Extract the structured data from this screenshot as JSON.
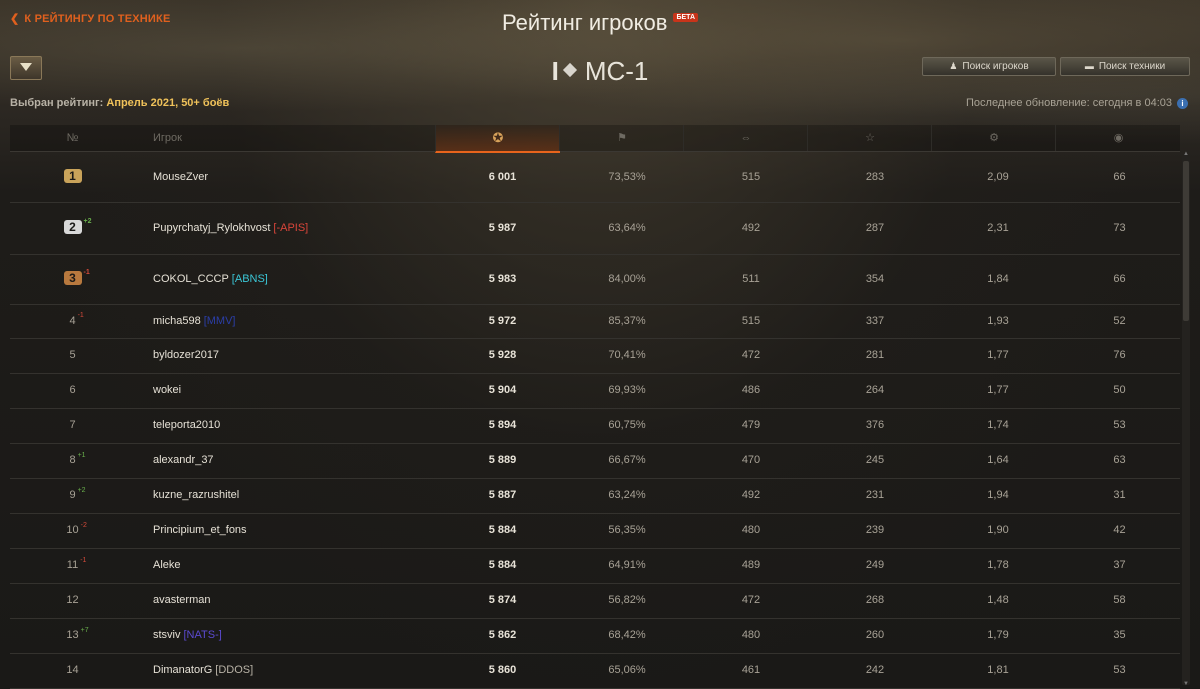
{
  "nav": {
    "back_label": "К РЕЙТИНГУ ПО ТЕХНИКЕ"
  },
  "header": {
    "title": "Рейтинг игроков",
    "beta_badge": "БЕТА"
  },
  "vehicle": {
    "tier": "I",
    "name": "МС-1"
  },
  "buttons": {
    "search_players": "Поиск игроков",
    "search_vehicles": "Поиск техники"
  },
  "rating": {
    "label": "Выбран рейтинг:",
    "value": "Апрель 2021, 50+ боёв"
  },
  "updated": {
    "label": "Последнее обновление: сегодня в 04:03"
  },
  "columns": {
    "rank": "№",
    "player": "Игрок",
    "score_icon": "medal-icon",
    "winrate_icon": "flag-icon",
    "damage_icon": "damage-icon",
    "experience_icon": "star-icon",
    "frags_icon": "destroyed-icon",
    "spotted_icon": "spotted-icon"
  },
  "colors": {
    "accent": "#e8641c",
    "gold": "#f0c25a",
    "up": "#6ab04c",
    "down": "#d34a3a"
  },
  "rows": [
    {
      "rank": "1",
      "medal": "gold",
      "delta": "",
      "player": "MouseZver",
      "clan": "",
      "clan_color": "",
      "score": "6 001",
      "winrate": "73,53%",
      "damage": "515",
      "exp": "283",
      "frags": "2,09",
      "spotted": "66"
    },
    {
      "rank": "2",
      "medal": "silver",
      "delta": "+2",
      "player": "Pupyrchatyj_Rylokhvost",
      "clan": "[-APIS]",
      "clan_color": "red",
      "score": "5 987",
      "winrate": "63,64%",
      "damage": "492",
      "exp": "287",
      "frags": "2,31",
      "spotted": "73"
    },
    {
      "rank": "3",
      "medal": "bronze",
      "delta": "-1",
      "player": "COKOL_CCCP",
      "clan": "[ABNS]",
      "clan_color": "cyan",
      "score": "5 983",
      "winrate": "84,00%",
      "damage": "511",
      "exp": "354",
      "frags": "1,84",
      "spotted": "66"
    },
    {
      "rank": "4",
      "medal": "",
      "delta": "-1",
      "player": "micha598",
      "clan": "[MMV]",
      "clan_color": "blue",
      "score": "5 972",
      "winrate": "85,37%",
      "damage": "515",
      "exp": "337",
      "frags": "1,93",
      "spotted": "52"
    },
    {
      "rank": "5",
      "medal": "",
      "delta": "",
      "player": "byldozer2017",
      "clan": "",
      "clan_color": "",
      "score": "5 928",
      "winrate": "70,41%",
      "damage": "472",
      "exp": "281",
      "frags": "1,77",
      "spotted": "76"
    },
    {
      "rank": "6",
      "medal": "",
      "delta": "",
      "player": "wokei",
      "clan": "",
      "clan_color": "",
      "score": "5 904",
      "winrate": "69,93%",
      "damage": "486",
      "exp": "264",
      "frags": "1,77",
      "spotted": "50"
    },
    {
      "rank": "7",
      "medal": "",
      "delta": "",
      "player": "teleporta2010",
      "clan": "",
      "clan_color": "",
      "score": "5 894",
      "winrate": "60,75%",
      "damage": "479",
      "exp": "376",
      "frags": "1,74",
      "spotted": "53"
    },
    {
      "rank": "8",
      "medal": "",
      "delta": "+1",
      "player": "alexandr_37",
      "clan": "",
      "clan_color": "",
      "score": "5 889",
      "winrate": "66,67%",
      "damage": "470",
      "exp": "245",
      "frags": "1,64",
      "spotted": "63"
    },
    {
      "rank": "9",
      "medal": "",
      "delta": "+2",
      "player": "kuzne_razrushitel",
      "clan": "",
      "clan_color": "",
      "score": "5 887",
      "winrate": "63,24%",
      "damage": "492",
      "exp": "231",
      "frags": "1,94",
      "spotted": "31"
    },
    {
      "rank": "10",
      "medal": "",
      "delta": "-2",
      "player": "Principium_et_fons",
      "clan": "",
      "clan_color": "",
      "score": "5 884",
      "winrate": "56,35%",
      "damage": "480",
      "exp": "239",
      "frags": "1,90",
      "spotted": "42"
    },
    {
      "rank": "11",
      "medal": "",
      "delta": "-1",
      "player": "Aleke",
      "clan": "",
      "clan_color": "",
      "score": "5 884",
      "winrate": "64,91%",
      "damage": "489",
      "exp": "249",
      "frags": "1,78",
      "spotted": "37"
    },
    {
      "rank": "12",
      "medal": "",
      "delta": "",
      "player": "avasterman",
      "clan": "",
      "clan_color": "",
      "score": "5 874",
      "winrate": "56,82%",
      "damage": "472",
      "exp": "268",
      "frags": "1,48",
      "spotted": "58"
    },
    {
      "rank": "13",
      "medal": "",
      "delta": "+7",
      "player": "stsviv",
      "clan": "[NATS-]",
      "clan_color": "purple",
      "score": "5 862",
      "winrate": "68,42%",
      "damage": "480",
      "exp": "260",
      "frags": "1,79",
      "spotted": "35"
    },
    {
      "rank": "14",
      "medal": "",
      "delta": "",
      "player": "DimanatorG",
      "clan": "[DDOS]",
      "clan_color": "grey",
      "score": "5 860",
      "winrate": "65,06%",
      "damage": "461",
      "exp": "242",
      "frags": "1,81",
      "spotted": "53"
    }
  ]
}
